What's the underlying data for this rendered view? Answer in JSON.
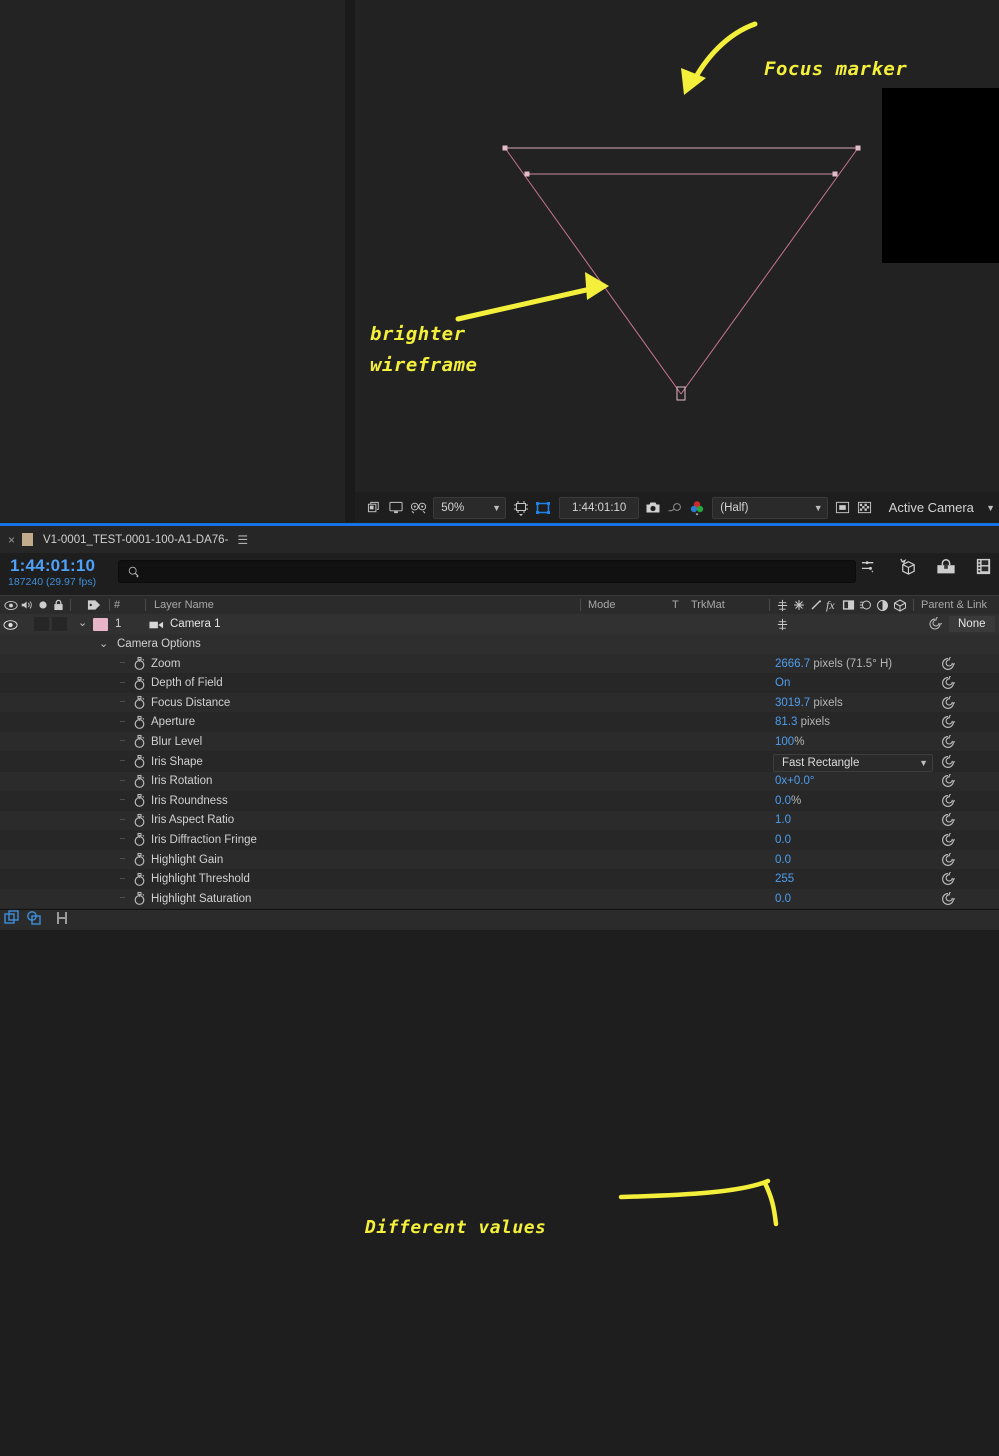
{
  "viewer": {
    "annotations": [
      {
        "name": "focus-marker",
        "text": "Focus marker"
      },
      {
        "name": "brighter-wireframe-line1",
        "text": "brighter"
      },
      {
        "name": "brighter-wireframe-line2",
        "text": "wireframe"
      }
    ],
    "toolbar": {
      "zoom_level": "50%",
      "timecode": "1:44:01:10",
      "resolution": "(Half)",
      "view": "Active Camera",
      "icons": [
        "take-snapshot-icon",
        "show-channel-icon",
        "3d-view-icon",
        "region-of-interest-icon",
        "transparency-grid-icon",
        "toggle-mask-icon",
        "toggle-guides-icon",
        "render-icon"
      ]
    }
  },
  "timeline": {
    "tab_label": "V1-0001_TEST-0001-100-A1-DA76-",
    "current_time": "1:44:01:10",
    "frame_info": "187240 (29.97 fps)",
    "search_placeholder": "",
    "columns": {
      "hash": "#",
      "layer_name": "Layer Name",
      "mode": "Mode",
      "t": "T",
      "trkmat": "TrkMat",
      "parent_link": "Parent & Link"
    },
    "layer": {
      "index": "1",
      "name": "Camera 1",
      "parent": "None",
      "label_color": "#e8b4c8"
    },
    "group_label": "Camera Options",
    "annotation": "Different values",
    "properties": [
      {
        "name": "Zoom",
        "value": "2666.7",
        "unit": " pixels (71.5° H)",
        "type": "number"
      },
      {
        "name": "Depth of Field",
        "value": "On",
        "unit": "",
        "type": "number"
      },
      {
        "name": "Focus Distance",
        "value": "3019.7",
        "unit": " pixels",
        "type": "number"
      },
      {
        "name": "Aperture",
        "value": "81.3",
        "unit": " pixels",
        "type": "number"
      },
      {
        "name": "Blur Level",
        "value": "100",
        "unit": "%",
        "type": "number"
      },
      {
        "name": "Iris Shape",
        "value": "Fast Rectangle",
        "unit": "",
        "type": "select"
      },
      {
        "name": "Iris Rotation",
        "value": "0x+0.0°",
        "unit": "",
        "type": "number"
      },
      {
        "name": "Iris Roundness",
        "value": "0.0",
        "unit": "%",
        "type": "number"
      },
      {
        "name": "Iris Aspect Ratio",
        "value": "1.0",
        "unit": "",
        "type": "number"
      },
      {
        "name": "Iris Diffraction Fringe",
        "value": "0.0",
        "unit": "",
        "type": "number"
      },
      {
        "name": "Highlight Gain",
        "value": "0.0",
        "unit": "",
        "type": "number"
      },
      {
        "name": "Highlight Threshold",
        "value": "255",
        "unit": "",
        "type": "number"
      },
      {
        "name": "Highlight Saturation",
        "value": "0.0",
        "unit": "",
        "type": "number"
      }
    ]
  },
  "colors": {
    "annotation_yellow": "#f3ef3a",
    "value_blue": "#4e9ef0",
    "timecode_blue": "#4ea1f7",
    "wireframe_pink": "#c9758f",
    "accent_blue": "#1473e6"
  }
}
